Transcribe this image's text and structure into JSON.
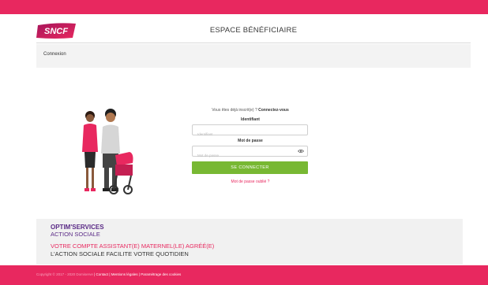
{
  "colors": {
    "brand_pink": "#e8285f",
    "brand_purple": "#5a2a86",
    "button_green": "#78b833"
  },
  "header": {
    "logo_text": "SNCF",
    "title": "ESPACE BÉNÉFICIAIRE"
  },
  "breadcrumb": "Connexion",
  "login": {
    "prompt_text": "Vous êtes déjà inscrit(e) ? ",
    "prompt_strong": "Connectez-vous",
    "identifier_label": "Identifiant",
    "identifier_placeholder": "Identifiant",
    "password_label": "Mot de passe",
    "password_placeholder": "Mot de passe",
    "submit_label": "SE CONNECTER",
    "forgot_label": "Mot de passe oublié ?"
  },
  "promo": {
    "line1": "OPTIM'SERVICES",
    "line2": "ACTION SOCIALE",
    "line3": "VOTRE COMPTE ASSISTANT(E) MATERNEL(LE) AGRÉÉ(E)",
    "line4": "L'ACTION SOCIALE FACILITE VOTRE QUOTIDIEN"
  },
  "footer": {
    "copyright": "Copyright © 2017 - 2020 Domiserve",
    "contact": "Contact",
    "legal": "Mentions légales",
    "cookies": "Paramétrage des cookies"
  },
  "icons": {
    "logo": "sncf-logo",
    "eye": "eye-icon",
    "illustration": "family-stroller-illustration"
  }
}
